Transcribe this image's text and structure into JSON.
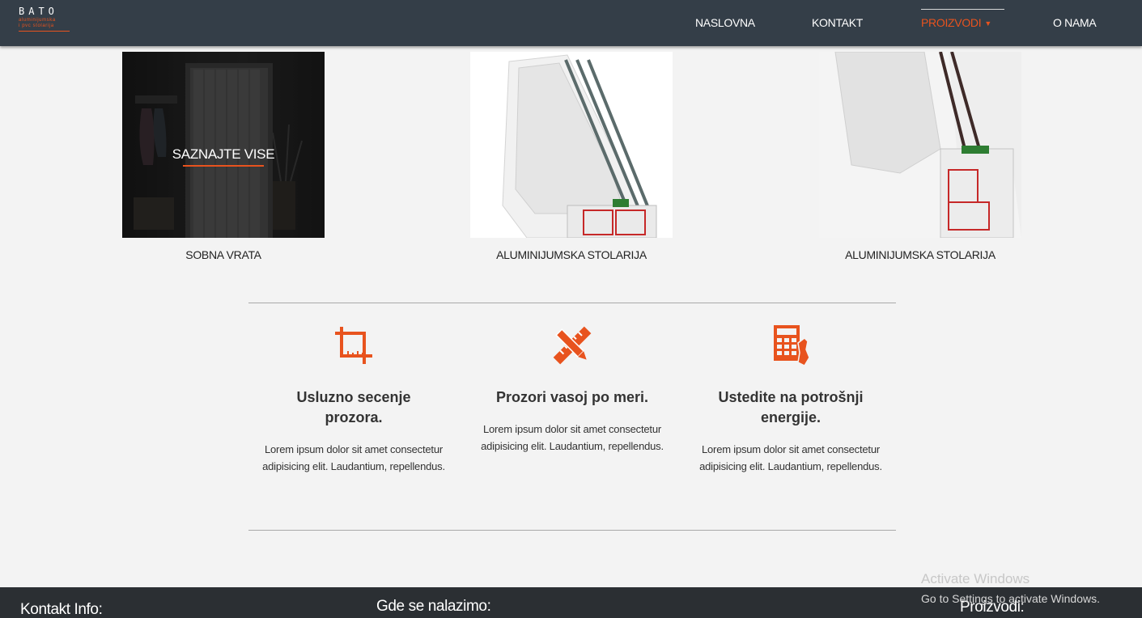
{
  "header": {
    "logo": {
      "word": "BATO",
      "line1": "aluminijumska",
      "line2": "i pvc stolarija"
    },
    "nav": [
      {
        "label": "NASLOVNA",
        "active": false
      },
      {
        "label": "KONTAKT",
        "active": false
      },
      {
        "label": "PROIZVODI",
        "active": true,
        "caret": "▼"
      },
      {
        "label": "O NAMA",
        "active": false
      }
    ]
  },
  "products": [
    {
      "caption": "SOBNA VRATA",
      "overlay_text": "SAZNAJTE VISE",
      "image": "interior-door-photo"
    },
    {
      "caption": "ALUMINIJUMSKA STOLARIJA",
      "image": "window-profile-cross-section"
    },
    {
      "caption": "ALUMINIJUMSKA STOLARIJA",
      "image": "window-profile-cross-section"
    }
  ],
  "features": [
    {
      "icon": "crop-icon",
      "title": "Usluzno secenje prozora.",
      "text": "Lorem ipsum dolor sit amet consectetur adipisicing elit. Laudantium, repellendus."
    },
    {
      "icon": "pencil-ruler-icon",
      "title": "Prozori vasoj po meri.",
      "text": "Lorem ipsum dolor sit amet consectetur adipisicing elit. Laudantium, repellendus."
    },
    {
      "icon": "calculator-hand-icon",
      "title": "Ustedite na potrošnji energije.",
      "text": "Lorem ipsum dolor sit amet consectetur adipisicing elit. Laudantium, repellendus."
    }
  ],
  "footer": {
    "contact_heading": "Kontakt Info:",
    "location_heading": "Gde se nalazimo:",
    "products_heading": "Proizvodi:"
  },
  "watermark": {
    "title": "Activate Windows",
    "subtitle": "Go to Settings to activate Windows."
  },
  "colors": {
    "accent": "#e8531e",
    "header_bg": "#343e48",
    "footer_bg": "#2b2f33",
    "page_bg": "#f3f3f3"
  }
}
